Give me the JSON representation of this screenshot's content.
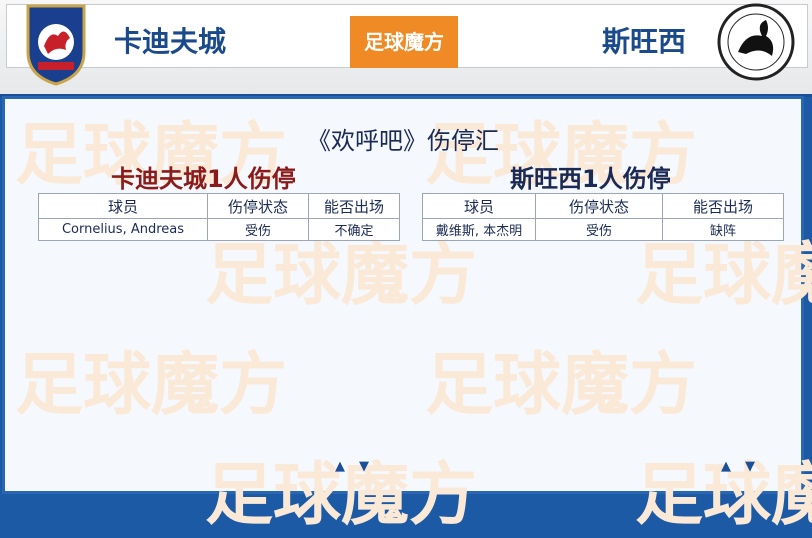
{
  "header": {
    "home_team": "卡迪夫城",
    "away_team": "斯旺西",
    "brand": "足球魔方",
    "home_crest_text": "CARDIFF CITY FC",
    "away_crest_text": "SWANSEA CITY AFC"
  },
  "section": {
    "title": "《欢呼吧》伤停汇"
  },
  "watermark": "足球魔方",
  "home_injuries": {
    "title": "卡迪夫城1人伤停",
    "columns": [
      "球员",
      "伤停状态",
      "能否出场"
    ],
    "rows": [
      [
        "Cornelius, Andreas",
        "受伤",
        "不确定"
      ]
    ]
  },
  "away_injuries": {
    "title": "斯旺西1人伤停",
    "columns": [
      "球员",
      "伤停状态",
      "能否出场"
    ],
    "rows": [
      [
        "戴维斯, 本杰明",
        "受伤",
        "缺阵"
      ]
    ]
  },
  "colors": {
    "brand_orange": "#f08a24",
    "frame_blue": "#2a67b3",
    "home_red": "#8b1a1a",
    "team_blue": "#1a4a8c"
  }
}
